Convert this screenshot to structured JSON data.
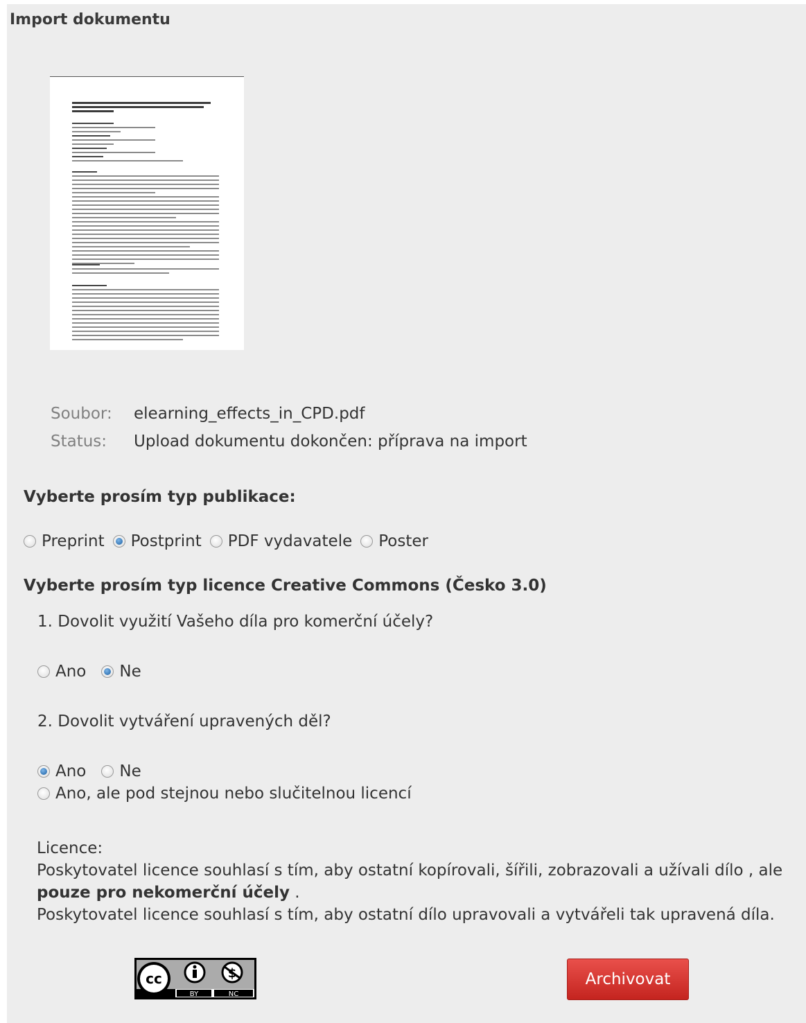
{
  "page": {
    "title": "Import dokumentu"
  },
  "file": {
    "file_label": "Soubor:",
    "file_name": "elearning_effects_in_CPD.pdf",
    "status_label": "Status:",
    "status_value": "Upload dokumentu dokončen: příprava na import"
  },
  "publication_type": {
    "heading": "Vyberte prosím typ publikace:",
    "options": [
      "Preprint",
      "Postprint",
      "PDF vydavatele",
      "Poster"
    ],
    "selected": "Postprint"
  },
  "license": {
    "heading": "Vyberte prosím typ licence Creative Commons (Česko 3.0)",
    "q1": "1. Dovolit využití Vašeho díla pro komerční účely?",
    "q1_options": [
      "Ano",
      "Ne"
    ],
    "q1_selected": "Ne",
    "q2": "2. Dovolit vytváření upravených děl?",
    "q2_options": [
      "Ano",
      "Ne",
      "Ano, ale pod stejnou nebo slučitelnou licencí"
    ],
    "q2_selected": "Ano",
    "summary_label": "Licence:",
    "summary_line1": "Poskytovatel licence souhlasí s tím, aby ostatní kopírovali, šířili, zobrazovali a užívali dílo , ale",
    "summary_bold": "pouze pro nekomerční účely",
    "summary_after_bold": " .",
    "summary_line2": "Poskytovatel licence souhlasí s tím, aby ostatní dílo upravovali a vytvářeli tak upravená díla.",
    "badge_text": [
      "cc",
      "BY",
      "NC"
    ]
  },
  "actions": {
    "archive_label": "Archivovat"
  },
  "colors": {
    "panel_bg": "#ededed",
    "button_red": "#d9332e",
    "radio_selected": "#1a5fa3"
  }
}
